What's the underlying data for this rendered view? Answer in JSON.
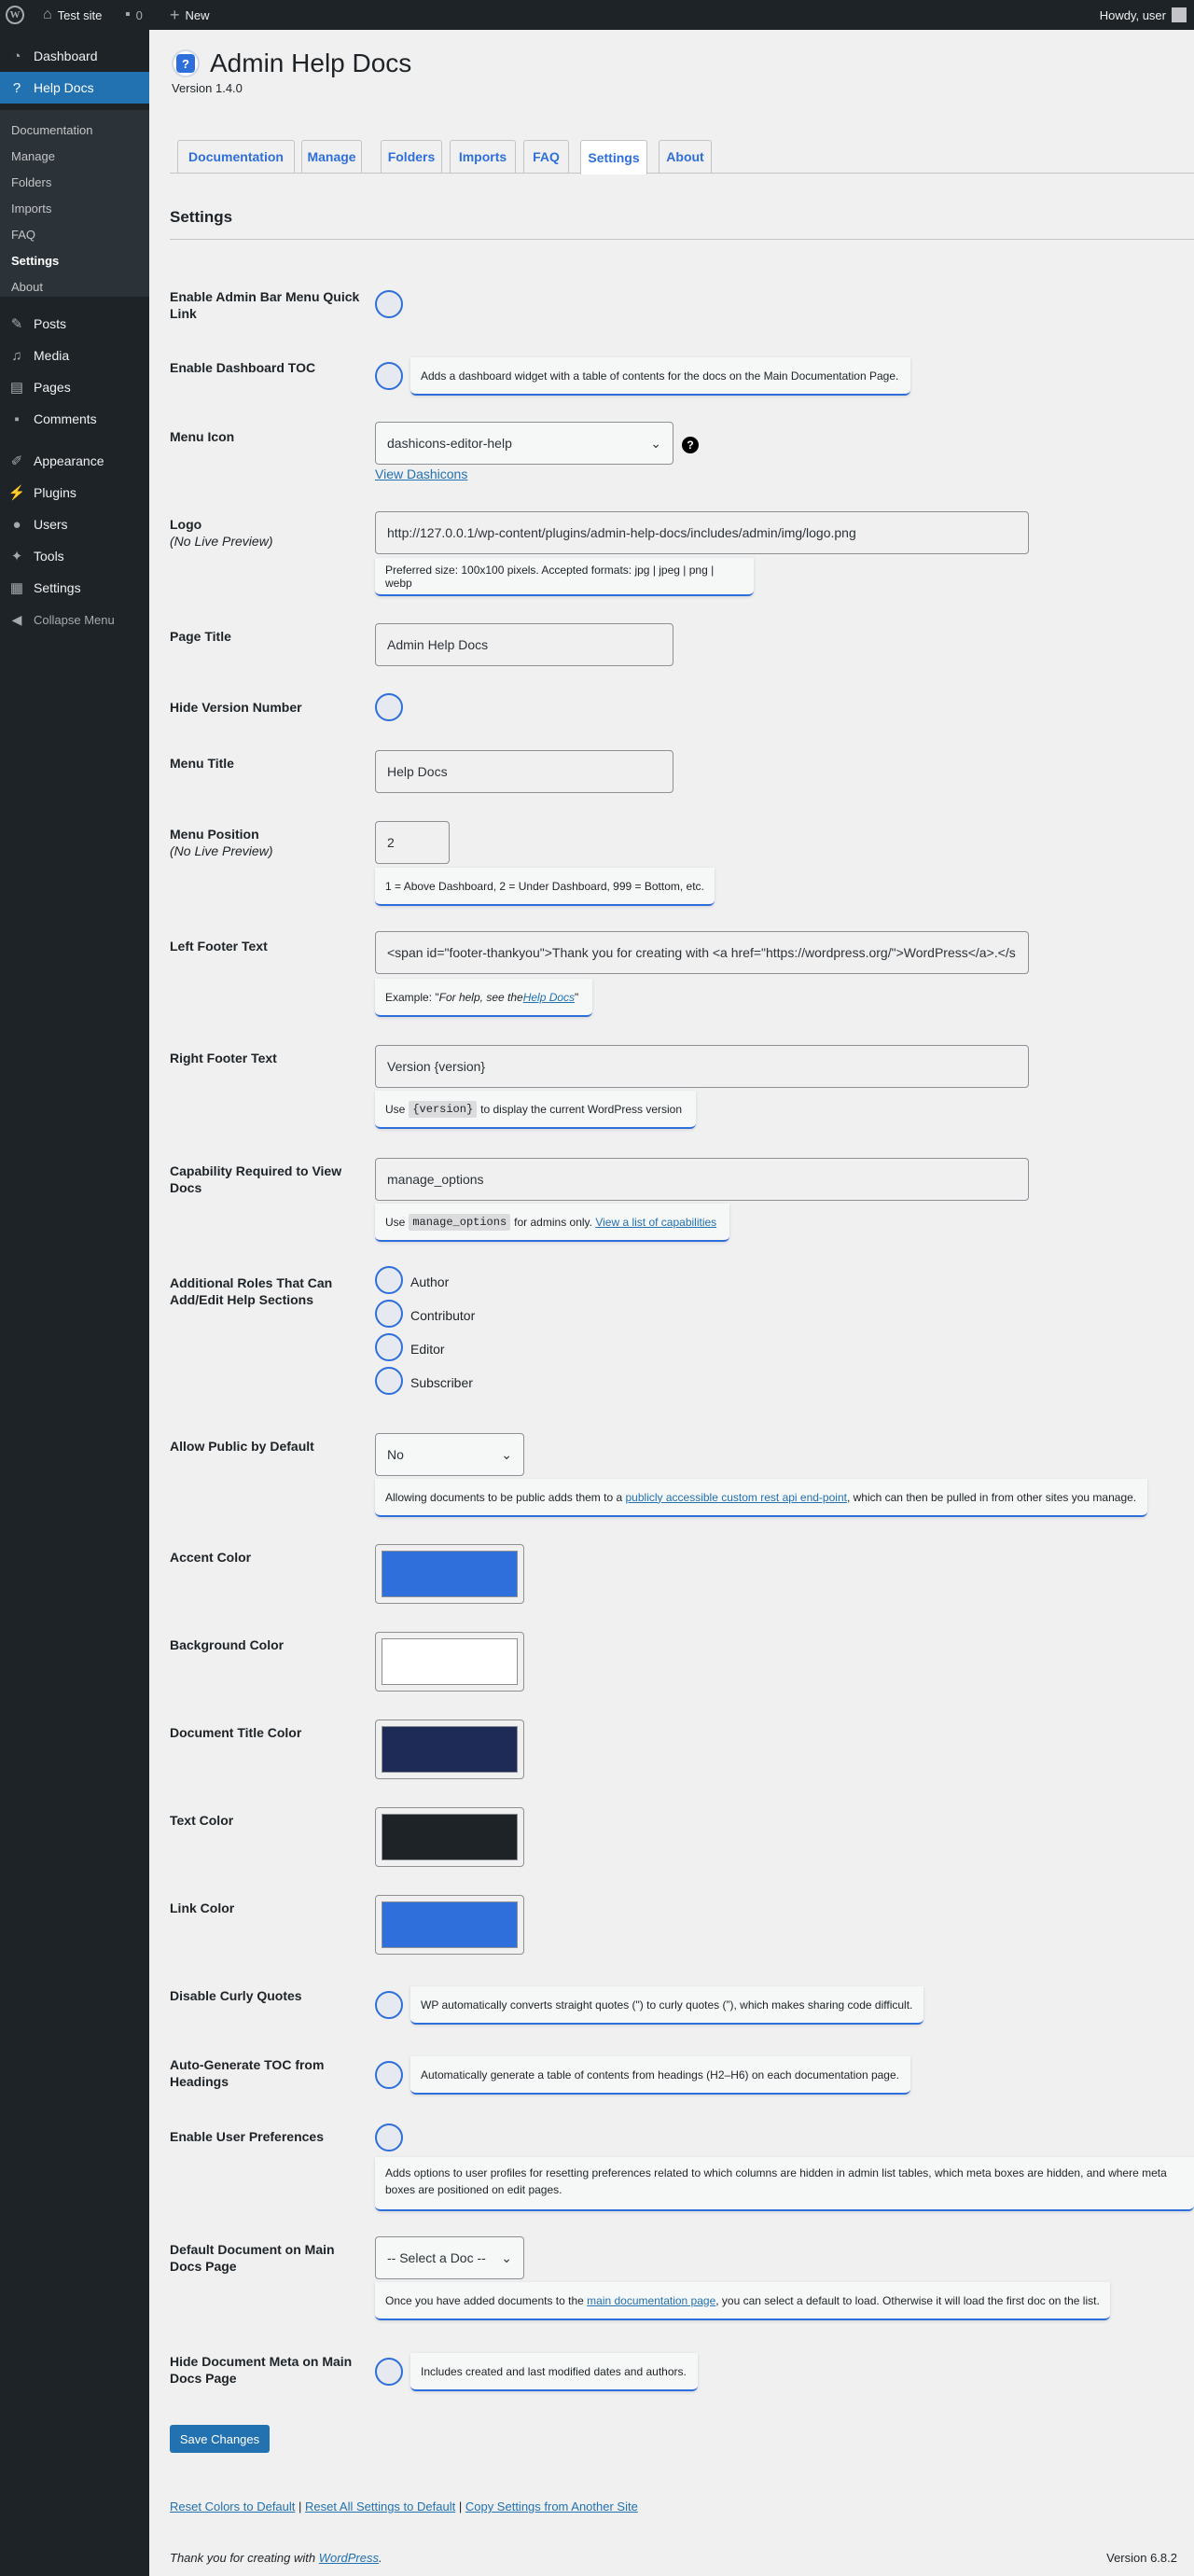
{
  "adminbar": {
    "site_name": "Test site",
    "comments_count": "0",
    "new_label": "New",
    "howdy": "Howdy, user"
  },
  "menu": {
    "dashboard": "Dashboard",
    "help_docs": "Help Docs",
    "submenu": [
      "Documentation",
      "Manage",
      "Folders",
      "Imports",
      "FAQ",
      "Settings",
      "About"
    ],
    "posts": "Posts",
    "media": "Media",
    "pages": "Pages",
    "comments": "Comments",
    "appearance": "Appearance",
    "plugins": "Plugins",
    "users": "Users",
    "tools": "Tools",
    "settings": "Settings",
    "collapse": "Collapse Menu"
  },
  "header": {
    "logo_glyph": "?",
    "title": "Admin Help Docs",
    "version": "Version 1.4.0"
  },
  "tabs": [
    "Documentation",
    "Manage",
    "Folders",
    "Imports",
    "FAQ",
    "Settings",
    "About"
  ],
  "section_title": "Settings",
  "settings": {
    "admin_bar_link": {
      "label": "Enable Admin Bar Menu Quick Link"
    },
    "dashboard_toc": {
      "label": "Enable Dashboard TOC",
      "note": "Adds a dashboard widget with a table of contents for the docs on the Main Documentation Page."
    },
    "menu_icon": {
      "label": "Menu Icon",
      "value": "dashicons-editor-help",
      "help_glyph": "?",
      "link": "View Dashicons"
    },
    "logo": {
      "label": "Logo",
      "sublabel": "(No Live Preview)",
      "value": "http://127.0.0.1/wp-content/plugins/admin-help-docs/includes/admin/img/logo.png",
      "note": "Preferred size: 100x100 pixels. Accepted formats: jpg | jpeg | png | webp"
    },
    "page_title": {
      "label": "Page Title",
      "value": "Admin Help Docs"
    },
    "hide_version": {
      "label": "Hide Version Number"
    },
    "menu_title": {
      "label": "Menu Title",
      "value": "Help Docs"
    },
    "menu_position": {
      "label": "Menu Position",
      "sublabel": "(No Live Preview)",
      "value": "2",
      "note": "1 = Above Dashboard, 2 = Under Dashboard, 999 = Bottom, etc."
    },
    "left_footer": {
      "label": "Left Footer Text",
      "value": "<span id=\"footer-thankyou\">Thank you for creating with <a href=\"https://wordpress.org/\">WordPress</a>.</s",
      "note_prefix": "Example: \"",
      "note_italic": "For help, see the ",
      "note_link": "Help Docs",
      "note_suffix": "\""
    },
    "right_footer": {
      "label": "Right Footer Text",
      "value": "Version {version}",
      "note_prefix": "Use",
      "note_code": "{version}",
      "note_suffix": "to display the current WordPress version"
    },
    "capability": {
      "label": "Capability Required to View Docs",
      "value": "manage_options",
      "note_prefix": "Use",
      "note_code": "manage_options",
      "note_middle": "for admins only.",
      "note_link": "View a list of capabilities"
    },
    "roles": {
      "label": "Additional Roles That Can Add/Edit Help Sections",
      "items": [
        "Author",
        "Contributor",
        "Editor",
        "Subscriber"
      ]
    },
    "public_default": {
      "label": "Allow Public by Default",
      "value": "No",
      "note_prefix": "Allowing documents to be public adds them to a",
      "note_link": "publicly accessible custom rest api end-point",
      "note_suffix": ", which can then be pulled in from other sites you manage."
    },
    "accent_color": {
      "label": "Accent Color",
      "color": "#2f6fdb"
    },
    "background_color": {
      "label": "Background Color",
      "color": "#ffffff"
    },
    "doc_title_color": {
      "label": "Document Title Color",
      "color": "#1f2b57"
    },
    "text_color": {
      "label": "Text Color",
      "color": "#1d2327"
    },
    "link_color": {
      "label": "Link Color",
      "color": "#2f6fdb"
    },
    "curly_quotes": {
      "label": "Disable Curly Quotes",
      "note": "WP automatically converts straight quotes (\") to curly quotes (”), which makes sharing code difficult."
    },
    "auto_toc": {
      "label": "Auto-Generate TOC from Headings",
      "note": "Automatically generate a table of contents from headings (H2–H6) on each documentation page."
    },
    "user_prefs": {
      "label": "Enable User Preferences",
      "note": "Adds options to user profiles for resetting preferences related to which columns are hidden in admin list tables, which meta boxes are hidden, and where meta boxes are positioned on edit pages."
    },
    "default_doc": {
      "label": "Default Document on Main Docs Page",
      "value": "-- Select a Doc --",
      "note_prefix": "Once you have added documents to the",
      "note_link": "main documentation page",
      "note_suffix": ", you can select a default to load. Otherwise it will load the first doc on the list."
    },
    "hide_meta": {
      "label": "Hide Document Meta on Main Docs Page",
      "note": "Includes created and last modified dates and authors."
    }
  },
  "save_button": "Save Changes",
  "footer_links": {
    "reset_colors": "Reset Colors to Default",
    "reset_all": "Reset All Settings to Default",
    "copy": "Copy Settings from Another Site",
    "sep": "|"
  },
  "footer": {
    "left_prefix": "Thank you for creating with",
    "left_link": "WordPress",
    "left_suffix": ".",
    "right": "Version 6.8.2"
  }
}
